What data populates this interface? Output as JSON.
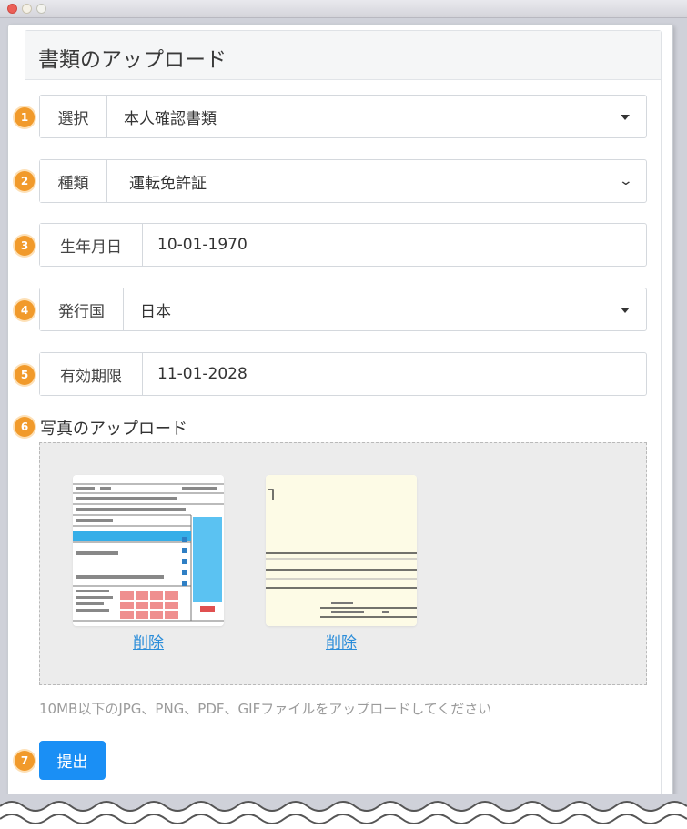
{
  "window": {
    "controls": [
      "close",
      "minimize",
      "zoom"
    ]
  },
  "header": {
    "title": "書類のアップロード"
  },
  "fields": [
    {
      "step": "1",
      "label": "選択",
      "value": "本人確認書類",
      "control": "caret"
    },
    {
      "step": "2",
      "label": "種類",
      "value": "運転免許証",
      "control": "chevron"
    },
    {
      "step": "3",
      "label": "生年月日",
      "value": "10-01-1970",
      "control": "none"
    },
    {
      "step": "4",
      "label": "発行国",
      "value": "日本",
      "control": "caret"
    },
    {
      "step": "5",
      "label": "有効期限",
      "value": "11-01-2028",
      "control": "none"
    }
  ],
  "photos": {
    "step": "6",
    "label": "写真のアップロード",
    "items": [
      {
        "delete_label": "削除"
      },
      {
        "delete_label": "削除"
      }
    ],
    "hint": "10MB以下のJPG、PNG、PDF、GIFファイルをアップロードしてください"
  },
  "submit": {
    "step": "7",
    "label": "提出"
  },
  "colors": {
    "badge": "#f19a2b",
    "primary": "#1a8ff5",
    "link": "#2b8dd9",
    "license_blue": "#5bc2f2"
  }
}
